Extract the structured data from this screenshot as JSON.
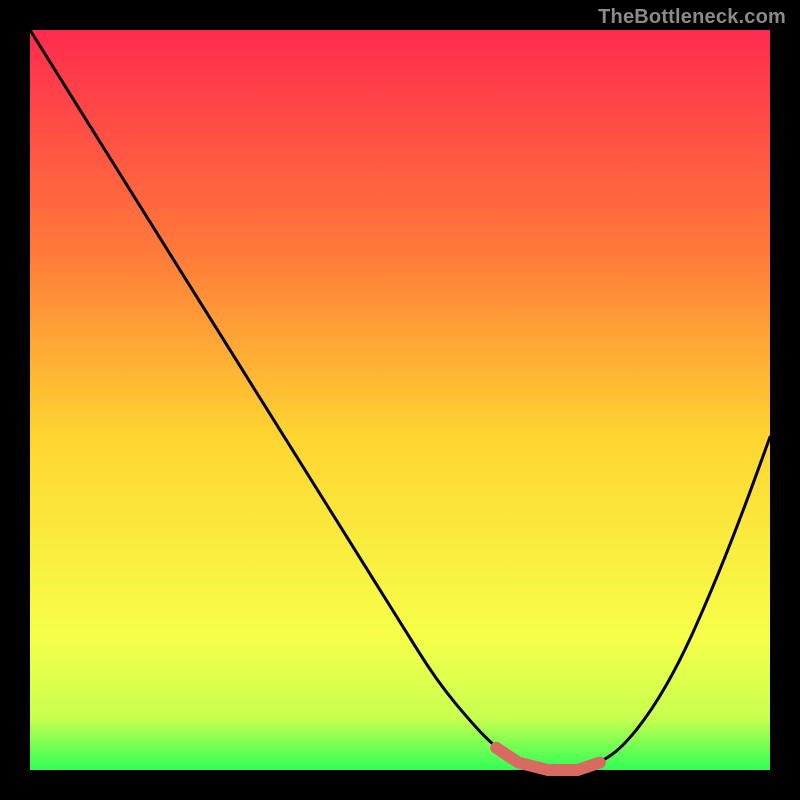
{
  "watermark": "TheBottleneck.com",
  "colors": {
    "frame": "#000000",
    "curve": "#000000",
    "highlight": "#d86a62",
    "gradient_top": "#ff2b4e",
    "gradient_mid1": "#ff7a3a",
    "gradient_mid2": "#ffd531",
    "gradient_mid3": "#f6ff4a",
    "gradient_bottom": "#2fff57"
  },
  "chart_data": {
    "type": "line",
    "title": "",
    "xlabel": "",
    "ylabel": "",
    "xlim": [
      0,
      100
    ],
    "ylim": [
      0,
      100
    ],
    "grid": false,
    "legend": false,
    "series": [
      {
        "name": "bottleneck-curve",
        "x": [
          0,
          5,
          10,
          15,
          20,
          25,
          30,
          35,
          40,
          45,
          50,
          55,
          60,
          63,
          66,
          70,
          74,
          77,
          80,
          84,
          88,
          92,
          96,
          100
        ],
        "values": [
          100,
          92,
          84,
          76,
          68,
          60,
          52,
          44,
          36,
          28,
          20,
          12,
          6,
          3,
          1,
          0,
          0,
          1,
          3,
          8,
          15,
          24,
          34,
          45
        ]
      }
    ],
    "highlight_range_x": [
      63,
      77
    ],
    "annotations": []
  }
}
